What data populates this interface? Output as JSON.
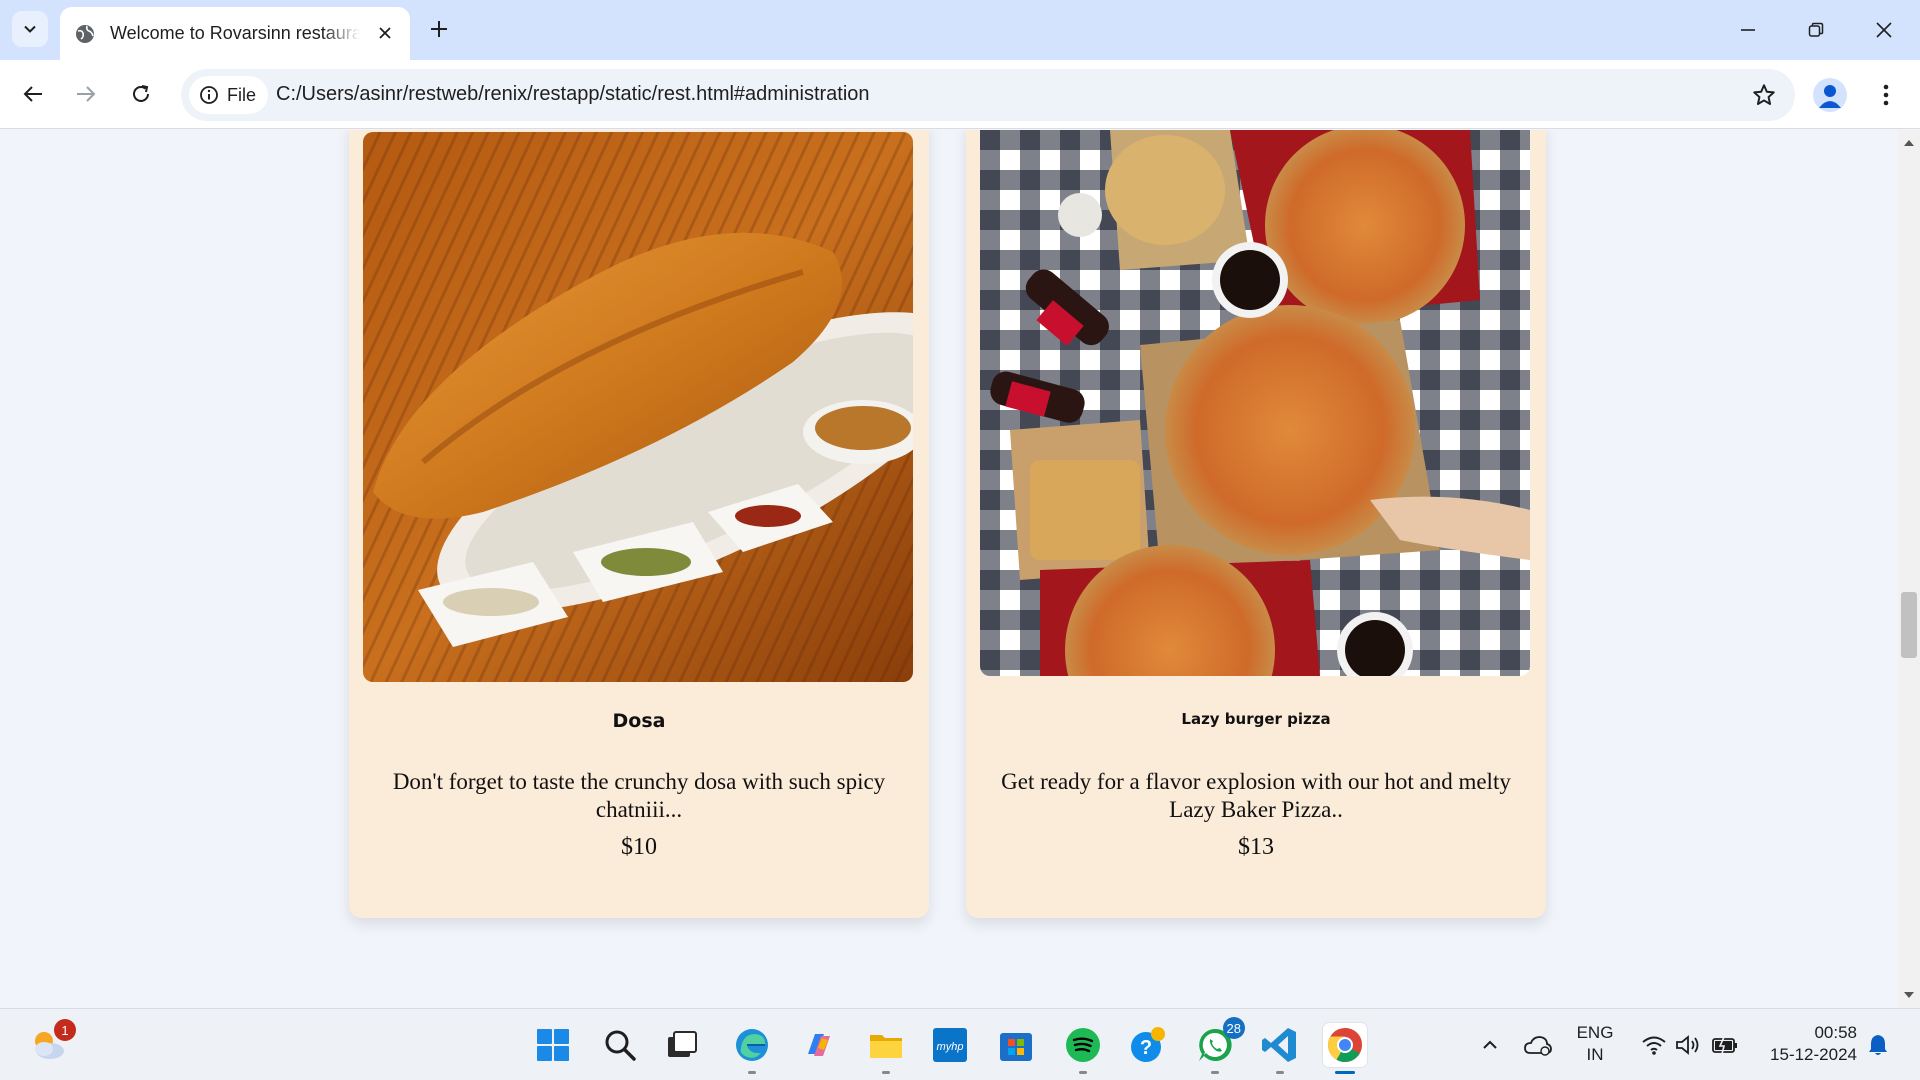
{
  "browser": {
    "tab_title": "Welcome to Rovarsinn restaurant",
    "security_chip": "File",
    "url": "C:/Users/asinr/restweb/renix/restapp/static/rest.html#administration"
  },
  "menu_items": [
    {
      "name": "Dosa",
      "description": "Don't forget to taste the crunchy dosa with such spicy chatniii...",
      "price": "$10",
      "image": "dosa-photo"
    },
    {
      "name": "Lazy burger pizza",
      "description": "Get ready for a flavor explosion with our hot and melty Lazy Baker Pizza..",
      "price": "$13",
      "image": "pizza-photo"
    }
  ],
  "taskbar": {
    "weather_badge": "1",
    "whatsapp_badge": "28",
    "language_line1": "ENG",
    "language_line2": "IN",
    "time": "00:58",
    "date": "15-12-2024"
  },
  "colors": {
    "card_background": "#fbebd9",
    "page_background": "#f1f4fb",
    "tabstrip": "#d3e3fd"
  }
}
